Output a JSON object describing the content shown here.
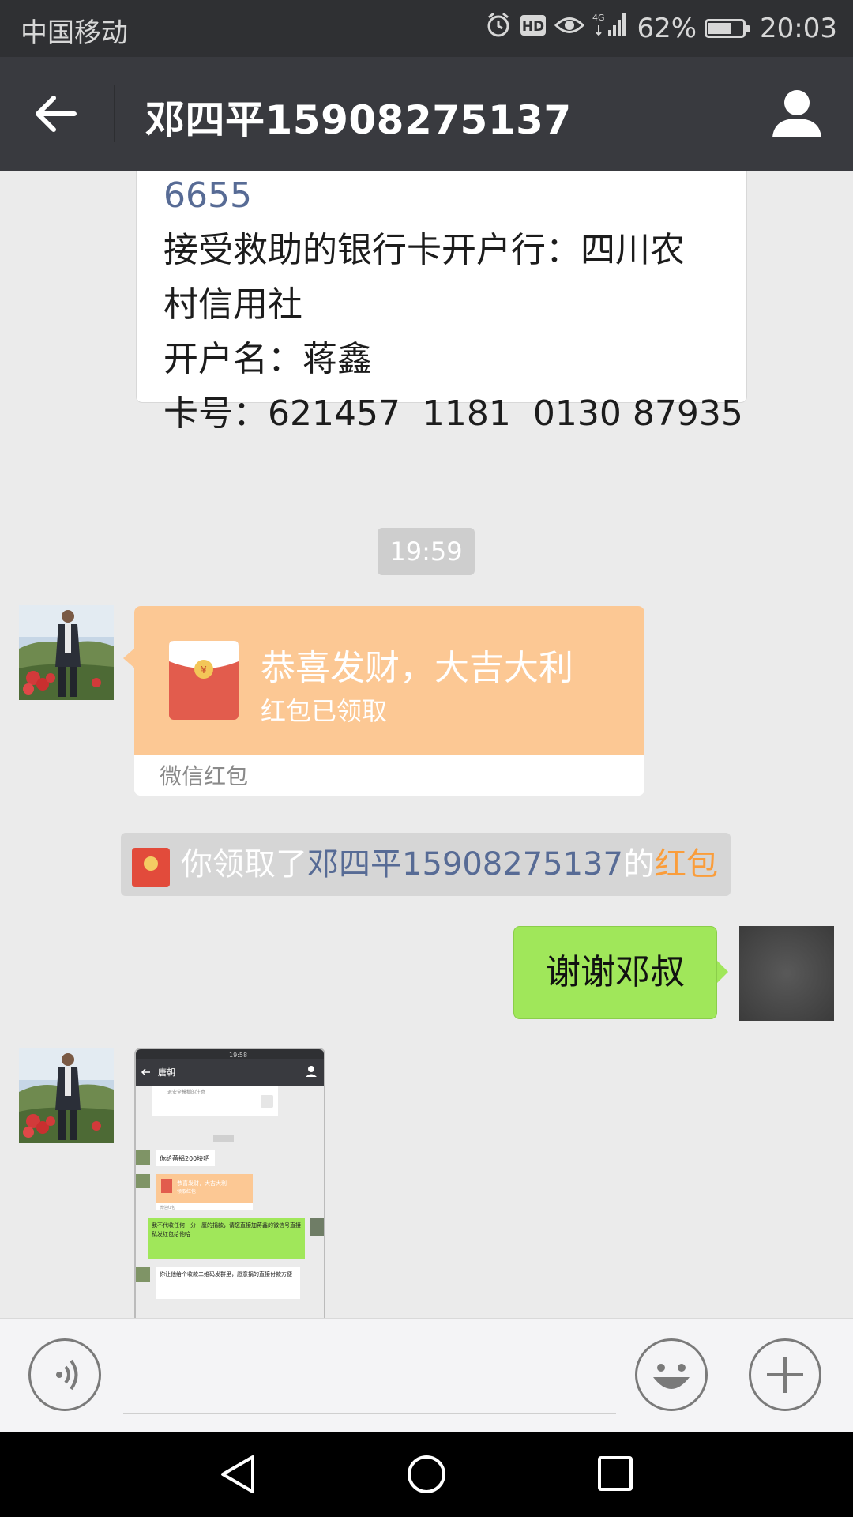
{
  "status_bar": {
    "carrier": "中国移动",
    "network": "4G",
    "battery_percent": "62%",
    "time": "20:03",
    "icons": [
      "alarm-icon",
      "hd-icon",
      "eye-icon",
      "signal-icon",
      "battery-icon"
    ]
  },
  "header": {
    "title": "邓四平15908275137",
    "icons": [
      "back-arrow-icon",
      "profile-icon"
    ]
  },
  "messages": {
    "card": {
      "line1": "6655",
      "line2": "接受救助的银行卡开户行：四川农",
      "line3": "村信用社",
      "line4": "开户名：蒋鑫",
      "line5": "卡号：621457  1181  0130 87935"
    },
    "timestamp": "19:59",
    "red_packet": {
      "title": "恭喜发财，大吉大利",
      "status": "红包已领取",
      "footer": "微信红包"
    },
    "notice": {
      "prefix": "你领取了",
      "name": "邓四平15908275137",
      "middle": "的",
      "link": "红包"
    },
    "my_message": "谢谢邓叔"
  },
  "screenshot_thumbnail": {
    "time": "19:58",
    "title": "唐朝",
    "top_note": "退安全模糊的注意",
    "bubble1": "你给蒂捐200块吧",
    "rp_title": "恭喜发财，大吉大利",
    "rp_sub": "领取红包",
    "rp_footer": "微信红包",
    "bubble2": "我不代收任何一分一厘的捐款，请您直接加蒋鑫的微信号直接私发红包给他哈",
    "bubble3": "你让他给个收款二维码发群里，愿意捐的直接付款方便"
  },
  "input_bar": {
    "icons": [
      "voice-icon",
      "emoji-icon",
      "plus-icon"
    ]
  },
  "nav_bar": {
    "icons": [
      "nav-back-icon",
      "nav-home-icon",
      "nav-recents-icon"
    ]
  },
  "colors": {
    "titlebar": "#393a3f",
    "statusbar": "#2f3033",
    "chat_bg": "#ebebeb",
    "red_packet": "#fcc894",
    "my_bubble": "#a0e75a",
    "link_blue": "#576b95",
    "link_orange": "#fa9d3b"
  }
}
